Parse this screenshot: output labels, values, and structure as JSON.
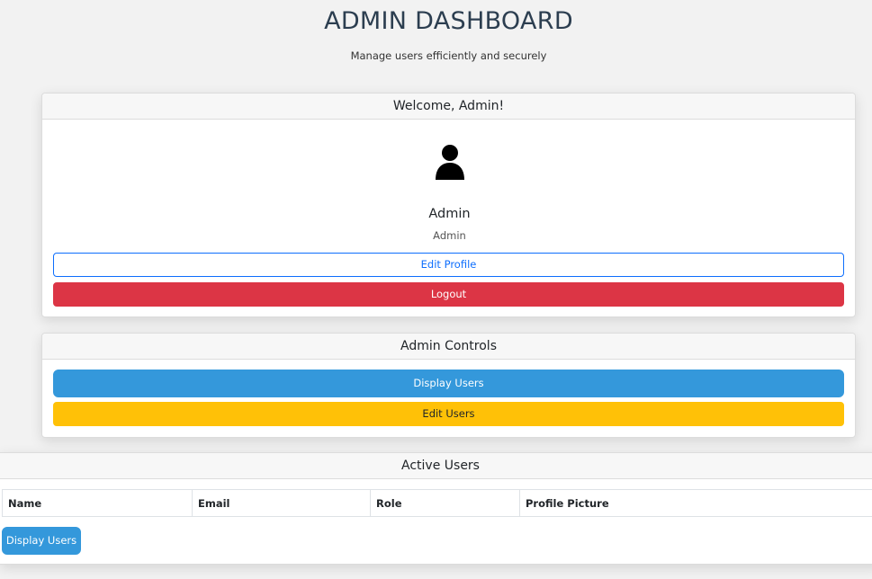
{
  "header": {
    "title": "ADMIN DASHBOARD",
    "subtitle": "Manage users efficiently and securely"
  },
  "welcome_card": {
    "heading": "Welcome, Admin!",
    "avatar_icon": "user-icon",
    "user_name": "Admin",
    "user_role": "Admin",
    "edit_profile_label": "Edit Profile",
    "logout_label": "Logout"
  },
  "controls_card": {
    "heading": "Admin Controls",
    "display_users_label": "Display Users",
    "edit_users_label": "Edit Users"
  },
  "users_card": {
    "heading": "Active Users",
    "columns": [
      "Name",
      "Email",
      "Role",
      "Profile Picture"
    ],
    "display_users_label": "Display Users"
  },
  "colors": {
    "primary": "#3498db",
    "outline": "#0d6efd",
    "danger": "#dc3545",
    "warning": "#ffc107",
    "title": "#2c3e50"
  }
}
